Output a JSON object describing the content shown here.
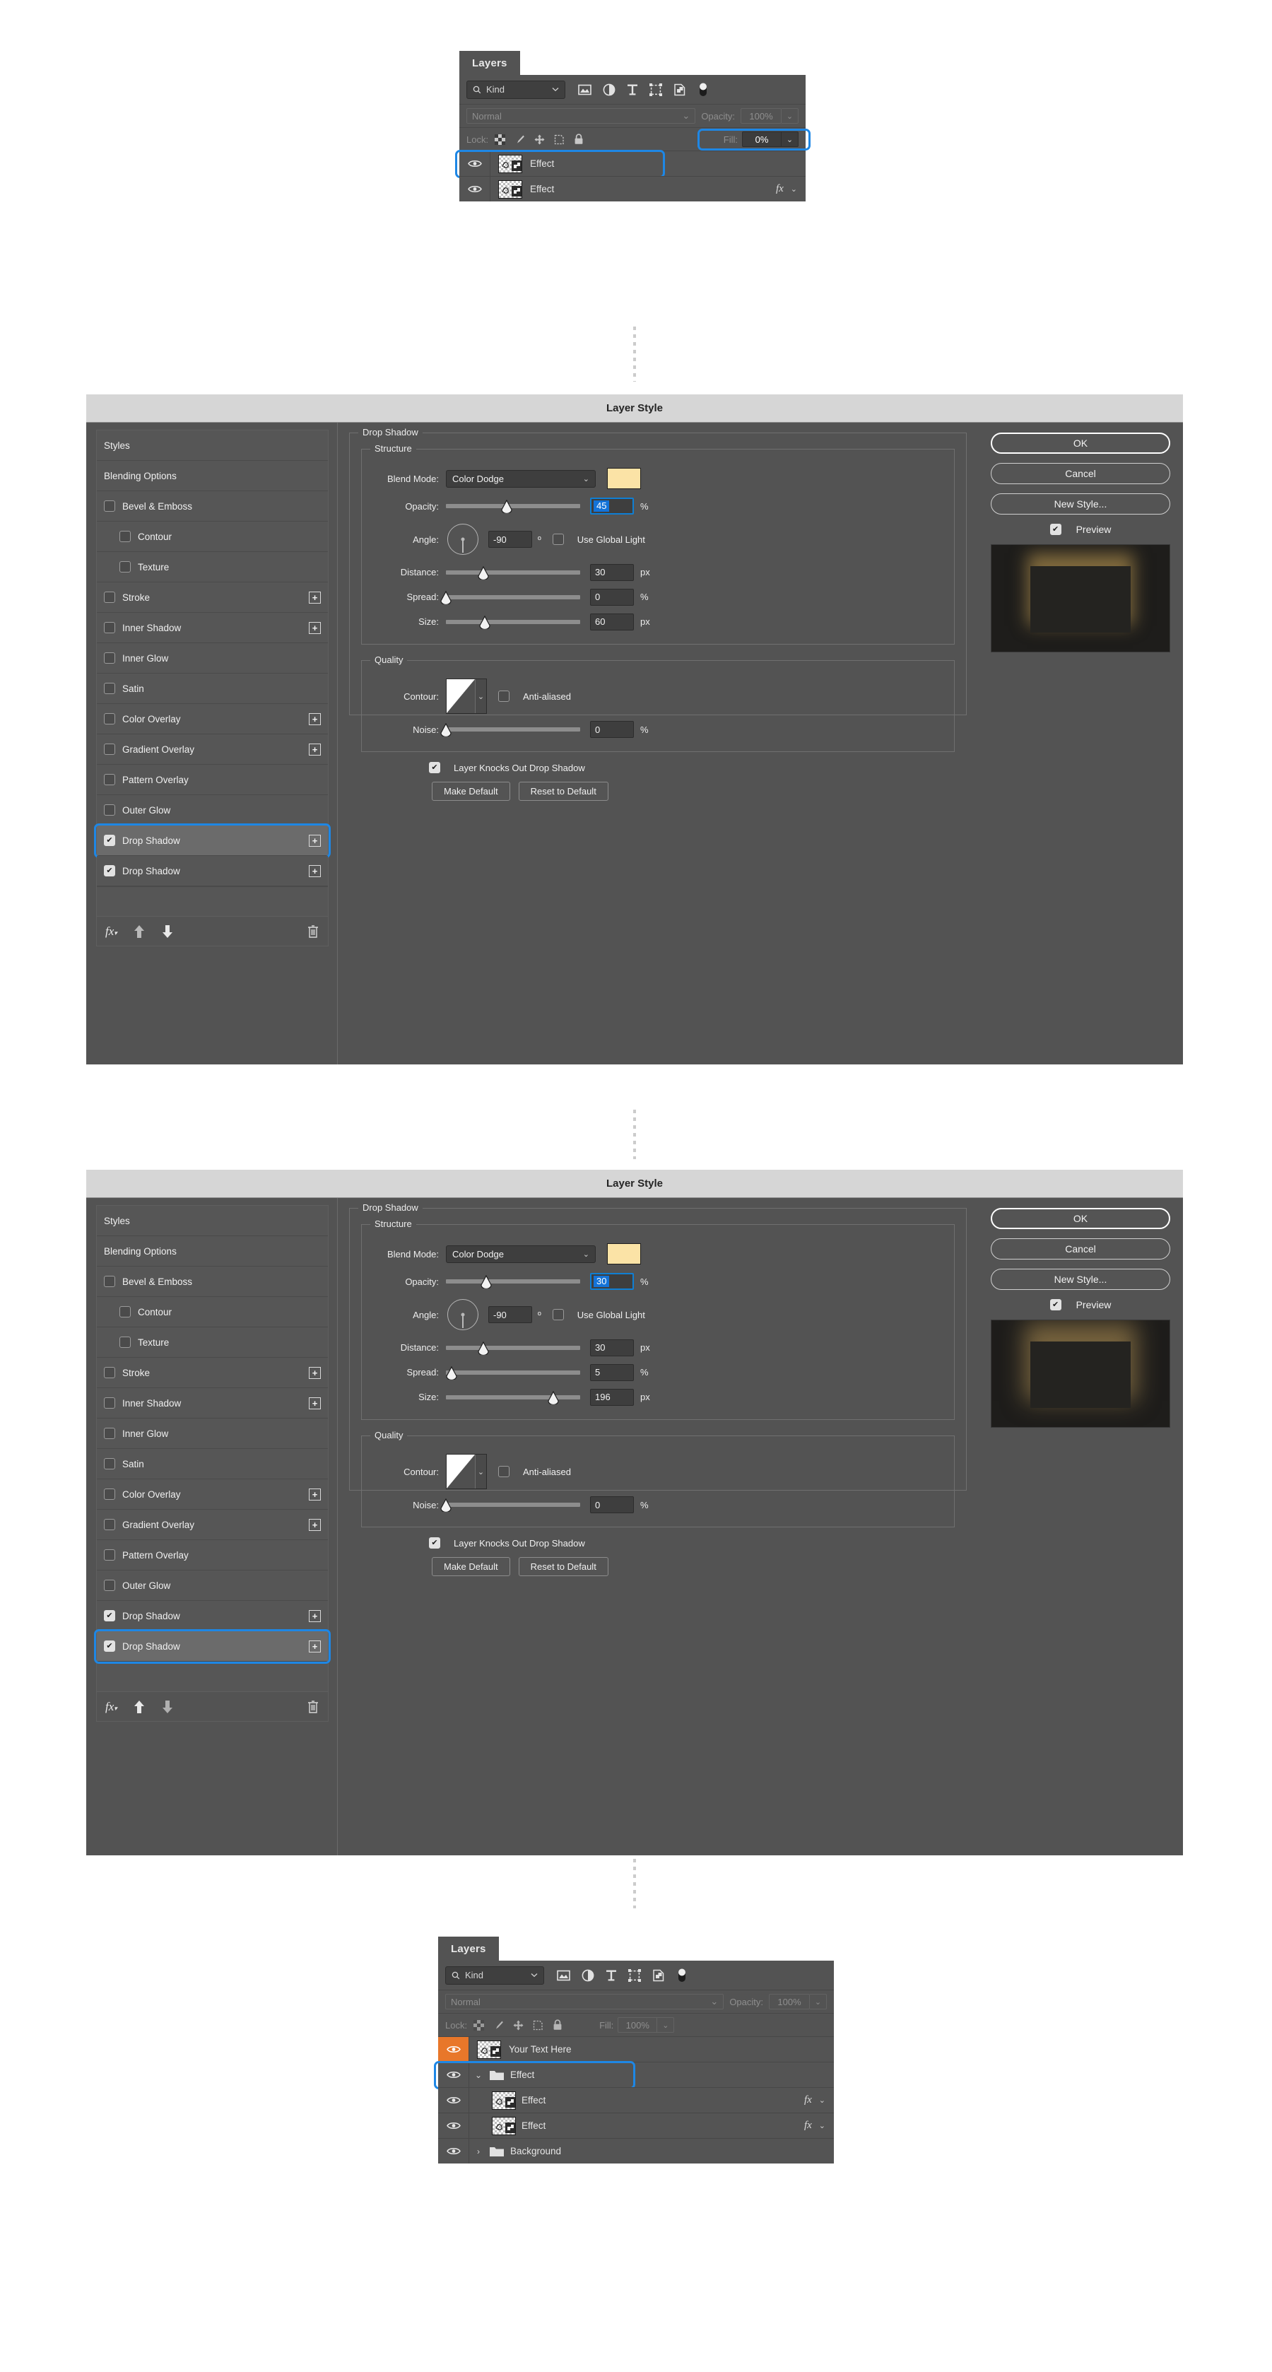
{
  "layers_panel_top": {
    "tab_label": "Layers",
    "filter": {
      "kind_label": "Kind",
      "search_icon": "search-icon",
      "chevron": "chevron-down-icon"
    },
    "filter_icons": [
      "pixel-layers-icon",
      "adjustment-layers-icon",
      "type-layers-icon",
      "shape-layers-icon",
      "smart-object-icon",
      "filter-toggle-icon"
    ],
    "blend_mode": "Normal",
    "opacity_label": "Opacity:",
    "opacity_value": "100%",
    "lock_label": "Lock:",
    "lock_icons": [
      "lock-transparent-pixels-icon",
      "lock-image-pixels-icon",
      "lock-position-icon",
      "lock-artboard-nesting-icon",
      "lock-all-icon"
    ],
    "fill_label": "Fill:",
    "fill_value": "0%",
    "rows": [
      {
        "name": "Effect",
        "visible": true,
        "has_fx": false,
        "highlighted": true
      },
      {
        "name": "Effect",
        "visible": true,
        "has_fx": true,
        "highlighted": false
      }
    ]
  },
  "dialog_one": {
    "title": "Layer Style",
    "styles_list": [
      {
        "label": "Styles",
        "type": "header"
      },
      {
        "label": "Blending Options",
        "type": "header"
      },
      {
        "label": "Bevel & Emboss",
        "checked": false,
        "indent": false,
        "plus": false
      },
      {
        "label": "Contour",
        "checked": false,
        "indent": true,
        "plus": false
      },
      {
        "label": "Texture",
        "checked": false,
        "indent": true,
        "plus": false
      },
      {
        "label": "Stroke",
        "checked": false,
        "indent": false,
        "plus": true
      },
      {
        "label": "Inner Shadow",
        "checked": false,
        "indent": false,
        "plus": true
      },
      {
        "label": "Inner Glow",
        "checked": false,
        "indent": false,
        "plus": false
      },
      {
        "label": "Satin",
        "checked": false,
        "indent": false,
        "plus": false
      },
      {
        "label": "Color Overlay",
        "checked": false,
        "indent": false,
        "plus": true
      },
      {
        "label": "Gradient Overlay",
        "checked": false,
        "indent": false,
        "plus": true
      },
      {
        "label": "Pattern Overlay",
        "checked": false,
        "indent": false,
        "plus": false
      },
      {
        "label": "Outer Glow",
        "checked": false,
        "indent": false,
        "plus": false
      },
      {
        "label": "Drop Shadow",
        "checked": true,
        "indent": false,
        "plus": true,
        "selected": true
      },
      {
        "label": "Drop Shadow",
        "checked": true,
        "indent": false,
        "plus": true
      }
    ],
    "footer_icons": [
      "fx-icon",
      "move-up-icon",
      "move-down-icon",
      "trash-icon"
    ],
    "footer_up_enabled": true,
    "footer_down_enabled": true,
    "section_title": "Drop Shadow",
    "structure_legend": "Structure",
    "blend_mode_label": "Blend Mode:",
    "blend_mode_value": "Color Dodge",
    "color_swatch": "#fbe3a6",
    "opacity_label": "Opacity:",
    "opacity_value": "45",
    "opacity_unit": "%",
    "opacity_pct": 45,
    "angle_label": "Angle:",
    "angle_value": "-90",
    "angle_unit": "º",
    "global_light_label": "Use Global Light",
    "global_light_checked": false,
    "distance_label": "Distance:",
    "distance_value": "30",
    "distance_unit": "px",
    "distance_pct": 28,
    "spread_label": "Spread:",
    "spread_value": "0",
    "spread_unit": "%",
    "spread_pct": 0,
    "size_label": "Size:",
    "size_value": "60",
    "size_unit": "px",
    "size_pct": 29,
    "quality_legend": "Quality",
    "contour_label": "Contour:",
    "antialias_label": "Anti-aliased",
    "antialias_checked": false,
    "noise_label": "Noise:",
    "noise_value": "0",
    "noise_unit": "%",
    "noise_pct": 0,
    "knockout_label": "Layer Knocks Out Drop Shadow",
    "knockout_checked": true,
    "make_default": "Make Default",
    "reset_default": "Reset to Default",
    "ok": "OK",
    "cancel": "Cancel",
    "new_style": "New Style...",
    "preview_label": "Preview",
    "preview_checked": true
  },
  "dialog_two": {
    "title": "Layer Style",
    "styles_list": [
      {
        "label": "Styles",
        "type": "header"
      },
      {
        "label": "Blending Options",
        "type": "header"
      },
      {
        "label": "Bevel & Emboss",
        "checked": false,
        "indent": false,
        "plus": false
      },
      {
        "label": "Contour",
        "checked": false,
        "indent": true,
        "plus": false
      },
      {
        "label": "Texture",
        "checked": false,
        "indent": true,
        "plus": false
      },
      {
        "label": "Stroke",
        "checked": false,
        "indent": false,
        "plus": true
      },
      {
        "label": "Inner Shadow",
        "checked": false,
        "indent": false,
        "plus": true
      },
      {
        "label": "Inner Glow",
        "checked": false,
        "indent": false,
        "plus": false
      },
      {
        "label": "Satin",
        "checked": false,
        "indent": false,
        "plus": false
      },
      {
        "label": "Color Overlay",
        "checked": false,
        "indent": false,
        "plus": true
      },
      {
        "label": "Gradient Overlay",
        "checked": false,
        "indent": false,
        "plus": true
      },
      {
        "label": "Pattern Overlay",
        "checked": false,
        "indent": false,
        "plus": false
      },
      {
        "label": "Outer Glow",
        "checked": false,
        "indent": false,
        "plus": false
      },
      {
        "label": "Drop Shadow",
        "checked": true,
        "indent": false,
        "plus": true
      },
      {
        "label": "Drop Shadow",
        "checked": true,
        "indent": false,
        "plus": true,
        "selected": true
      }
    ],
    "footer_icons": [
      "fx-icon",
      "move-up-icon",
      "move-down-icon",
      "trash-icon"
    ],
    "footer_up_enabled": true,
    "footer_down_enabled": false,
    "section_title": "Drop Shadow",
    "structure_legend": "Structure",
    "blend_mode_label": "Blend Mode:",
    "blend_mode_value": "Color Dodge",
    "color_swatch": "#fbe3a6",
    "opacity_label": "Opacity:",
    "opacity_value": "30",
    "opacity_unit": "%",
    "opacity_pct": 30,
    "angle_label": "Angle:",
    "angle_value": "-90",
    "angle_unit": "º",
    "global_light_label": "Use Global Light",
    "global_light_checked": false,
    "distance_label": "Distance:",
    "distance_value": "30",
    "distance_unit": "px",
    "distance_pct": 28,
    "spread_label": "Spread:",
    "spread_value": "5",
    "spread_unit": "%",
    "spread_pct": 4,
    "size_label": "Size:",
    "size_value": "196",
    "size_unit": "px",
    "size_pct": 80,
    "quality_legend": "Quality",
    "contour_label": "Contour:",
    "antialias_label": "Anti-aliased",
    "antialias_checked": false,
    "noise_label": "Noise:",
    "noise_value": "0",
    "noise_unit": "%",
    "noise_pct": 0,
    "knockout_label": "Layer Knocks Out Drop Shadow",
    "knockout_checked": true,
    "make_default": "Make Default",
    "reset_default": "Reset to Default",
    "ok": "OK",
    "cancel": "Cancel",
    "new_style": "New Style...",
    "preview_label": "Preview",
    "preview_checked": true
  },
  "layers_panel_bottom": {
    "tab_label": "Layers",
    "filter": {
      "kind_label": "Kind",
      "search_icon": "search-icon",
      "chevron": "chevron-down-icon"
    },
    "blend_mode": "Normal",
    "opacity_label": "Opacity:",
    "opacity_value": "100%",
    "lock_label": "Lock:",
    "fill_label": "Fill:",
    "fill_value": "100%",
    "rows": [
      {
        "name": "Your Text Here",
        "visible": true,
        "eye_highlight": true,
        "kind": "layer",
        "has_fx": false
      },
      {
        "name": "Effect",
        "visible": true,
        "kind": "group-open",
        "has_fx": false,
        "highlighted": true
      },
      {
        "name": "Effect",
        "visible": true,
        "kind": "layer",
        "has_fx": true,
        "child": true
      },
      {
        "name": "Effect",
        "visible": true,
        "kind": "layer",
        "has_fx": true,
        "child": true
      },
      {
        "name": "Background",
        "visible": true,
        "kind": "group-closed",
        "has_fx": false
      }
    ]
  },
  "colors": {
    "highlight_blue": "#1e87e5",
    "panel_bg": "#535353",
    "title_bg": "#d6d6d6",
    "eye_highlight_orange": "#e8772a",
    "focus_blue": "#1473d8"
  }
}
